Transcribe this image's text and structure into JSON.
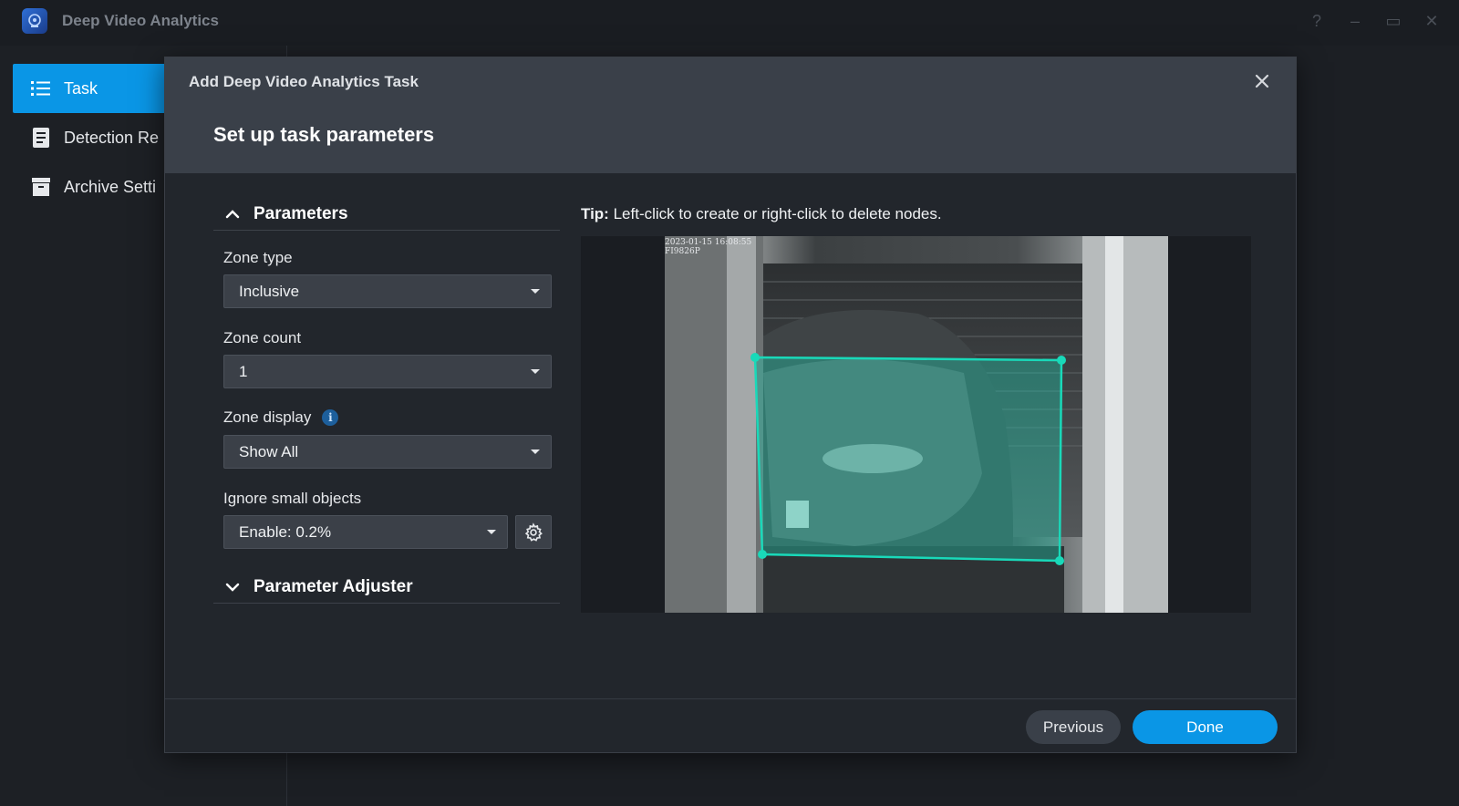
{
  "app": {
    "title": "Deep Video Analytics",
    "window_controls": [
      "?",
      "–",
      "▭",
      "✕"
    ]
  },
  "sidebar": {
    "items": [
      {
        "label": "Task",
        "icon": "list-icon",
        "active": true
      },
      {
        "label": "Detection Re",
        "icon": "document-icon",
        "active": false
      },
      {
        "label": "Archive Setti",
        "icon": "archive-icon",
        "active": false
      }
    ]
  },
  "modal": {
    "title": "Add Deep Video Analytics Task",
    "subtitle": "Set up task parameters",
    "close_icon": "close-icon"
  },
  "parameters": {
    "section_title": "Parameters",
    "zone_type": {
      "label": "Zone type",
      "value": "Inclusive"
    },
    "zone_count": {
      "label": "Zone count",
      "value": "1"
    },
    "zone_display": {
      "label": "Zone display",
      "value": "Show All",
      "info_icon": "i"
    },
    "ignore_small": {
      "label": "Ignore small objects",
      "value": "Enable: 0.2%"
    },
    "adjuster_title": "Parameter Adjuster"
  },
  "preview": {
    "tip_bold": "Tip:",
    "tip_text": " Left-click to create or right-click to delete nodes.",
    "overlay_timestamp": "2023-01-15 16:08:55",
    "overlay_camera": "FI9826P",
    "zone_color": "#19d9b9"
  },
  "footer": {
    "previous_label": "Previous",
    "done_label": "Done"
  },
  "colors": {
    "accent": "#0a96e6",
    "header_bg": "#3a4049",
    "panel_bg": "#22262c"
  }
}
